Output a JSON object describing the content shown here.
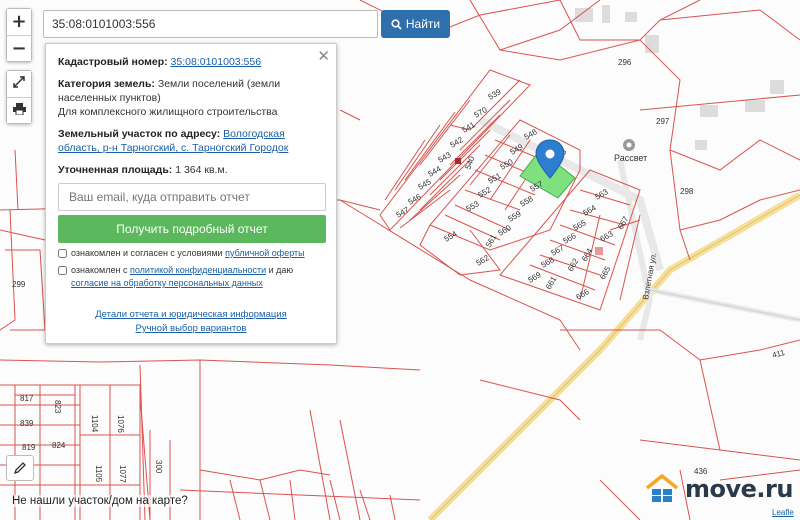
{
  "search": {
    "value": "35:08:0101003:556",
    "button_label": "Найти"
  },
  "controls": {
    "zoom_in": "+",
    "zoom_out": "−"
  },
  "panel": {
    "cadastral_label": "Кадастровый номер:",
    "cadastral_value": "35:08:0101003:556",
    "category_label": "Категория земель:",
    "category_value": "Земли поселений (земли населенных пунктов)",
    "use_value": "Для комплексного жилищного строительства",
    "address_label": "Земельный участок по адресу:",
    "address_value": "Вологодская область, р-н Тарногский, с. Тарногский Городок",
    "area_label": "Уточненная площадь:",
    "area_value": "1 364 кв.м.",
    "email_placeholder": "Ваш email, куда отправить отчет",
    "report_button": "Получить подробный отчет",
    "check1_text": "ознакомлен и согласен с условиями",
    "check1_link": "публичной оферты",
    "check2_text": "ознакомлен с",
    "check2_link": "политикой конфиденциальности",
    "check2_text2": "и даю",
    "check2_link2": "согласие на обработку персональных данных",
    "link_details": "Детали отчета и юридическая информация",
    "link_manual": "Ручной выбор вариантов"
  },
  "footer": {
    "not_found": "Не нашли участок/дом на карте?",
    "attribution": "Leafle"
  },
  "logo": {
    "text": "move.ru"
  },
  "map": {
    "parcel_labels": [
      "539",
      "570",
      "541",
      "542",
      "543",
      "540",
      "544",
      "545",
      "546",
      "547",
      "548",
      "549",
      "550",
      "551",
      "552",
      "553",
      "554",
      "555",
      "557",
      "558",
      "559",
      "560",
      "561",
      "562",
      "563",
      "564",
      "565",
      "566",
      "567",
      "568",
      "569",
      "661",
      "662",
      "663",
      "664",
      "665",
      "666",
      "667",
      "296",
      "297",
      "298",
      "299",
      "411",
      "436",
      "817",
      "823",
      "839",
      "819",
      "824",
      "1104",
      "1076",
      "1105",
      "1077",
      "300"
    ],
    "place_label": "Рассвет",
    "street_label": "Взлетная ул."
  },
  "colors": {
    "line": "#d9534f",
    "parcel_fill": "#7ee07e",
    "marker": "#2c7fd0",
    "button_blue": "#2f6fad",
    "button_green": "#5cb85c"
  }
}
